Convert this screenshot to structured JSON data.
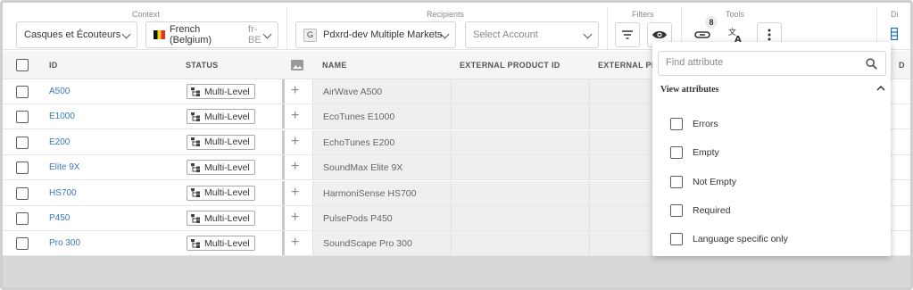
{
  "toolbar": {
    "context_label": "Context",
    "context_select": "Casques et Écouteurs",
    "locale_select": "French (Belgium)",
    "locale_code": "fr-BE",
    "recipients_label": "Recipients",
    "recipient_badge": "G",
    "recipient_select": "Pdxrd-dev Multiple Markets",
    "account_placeholder": "Select Account",
    "filters_label": "Filters",
    "tools_label": "Tools",
    "tools_badge_count": "8",
    "display_label": "Di"
  },
  "table": {
    "headers": {
      "id": "ID",
      "status": "STATUS",
      "name": "NAME",
      "external_product_id": "EXTERNAL PRODUCT ID",
      "external_pro": "EXTERNAL PRO",
      "last": "D"
    },
    "rows": [
      {
        "id": "A500",
        "status": "Multi-Level",
        "name": "AirWave A500"
      },
      {
        "id": "E1000",
        "status": "Multi-Level",
        "name": "EcoTunes E1000"
      },
      {
        "id": "E200",
        "status": "Multi-Level",
        "name": "EchoTunes E200"
      },
      {
        "id": "Elite 9X",
        "status": "Multi-Level",
        "name": "SoundMax Elite 9X"
      },
      {
        "id": "HS700",
        "status": "Multi-Level",
        "name": "HarmoniSense HS700"
      },
      {
        "id": "P450",
        "status": "Multi-Level",
        "name": "PulsePods P450"
      },
      {
        "id": "Pro 300",
        "status": "Multi-Level",
        "name": "SoundScape Pro 300"
      }
    ]
  },
  "attribute_panel": {
    "search_placeholder": "Find attribute",
    "section_title": "View attributes",
    "options": [
      "Errors",
      "Empty",
      "Not Empty",
      "Required",
      "Language specific only"
    ]
  },
  "colors": {
    "link": "#3a78b8",
    "header_bg": "#f5f5f5",
    "accent": "#1f6fbf"
  }
}
